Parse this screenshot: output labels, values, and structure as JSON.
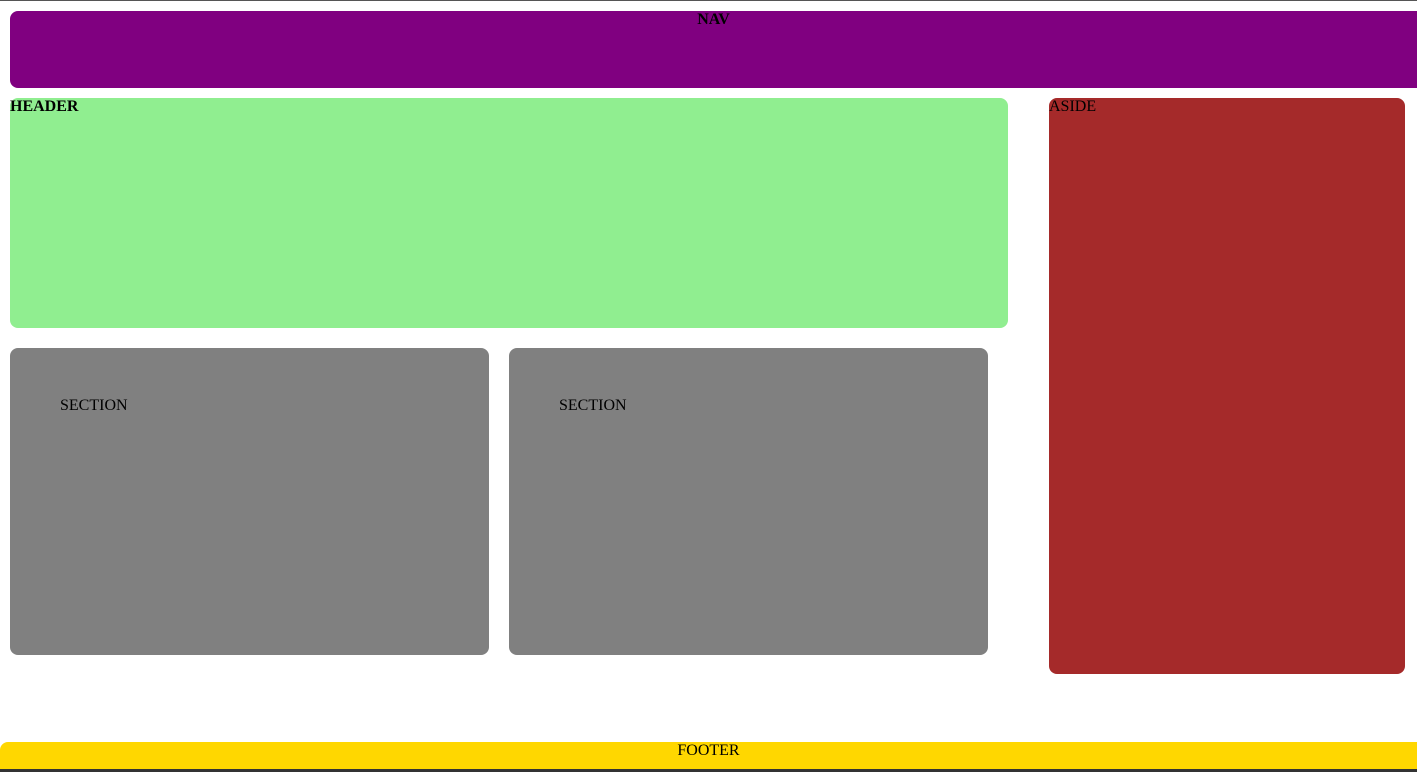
{
  "nav": {
    "label": "NAV",
    "color": "#800080"
  },
  "header": {
    "label": "HEADER",
    "color": "#90EE90"
  },
  "aside": {
    "label": "ASIDE",
    "color": "#A52A2A"
  },
  "sections": [
    {
      "label": "SECTION",
      "color": "#808080"
    },
    {
      "label": "SECTION",
      "color": "#808080"
    }
  ],
  "footer": {
    "label": "FOOTER",
    "color": "#FFD700"
  }
}
